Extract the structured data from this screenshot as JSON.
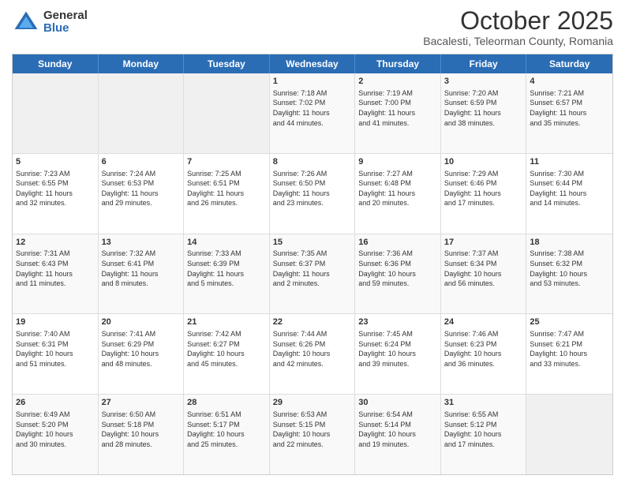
{
  "header": {
    "logo_general": "General",
    "logo_blue": "Blue",
    "title": "October 2025",
    "location": "Bacalesti, Teleorman County, Romania"
  },
  "weekdays": [
    "Sunday",
    "Monday",
    "Tuesday",
    "Wednesday",
    "Thursday",
    "Friday",
    "Saturday"
  ],
  "rows": [
    [
      {
        "day": "",
        "info": ""
      },
      {
        "day": "",
        "info": ""
      },
      {
        "day": "",
        "info": ""
      },
      {
        "day": "1",
        "info": "Sunrise: 7:18 AM\nSunset: 7:02 PM\nDaylight: 11 hours\nand 44 minutes."
      },
      {
        "day": "2",
        "info": "Sunrise: 7:19 AM\nSunset: 7:00 PM\nDaylight: 11 hours\nand 41 minutes."
      },
      {
        "day": "3",
        "info": "Sunrise: 7:20 AM\nSunset: 6:59 PM\nDaylight: 11 hours\nand 38 minutes."
      },
      {
        "day": "4",
        "info": "Sunrise: 7:21 AM\nSunset: 6:57 PM\nDaylight: 11 hours\nand 35 minutes."
      }
    ],
    [
      {
        "day": "5",
        "info": "Sunrise: 7:23 AM\nSunset: 6:55 PM\nDaylight: 11 hours\nand 32 minutes."
      },
      {
        "day": "6",
        "info": "Sunrise: 7:24 AM\nSunset: 6:53 PM\nDaylight: 11 hours\nand 29 minutes."
      },
      {
        "day": "7",
        "info": "Sunrise: 7:25 AM\nSunset: 6:51 PM\nDaylight: 11 hours\nand 26 minutes."
      },
      {
        "day": "8",
        "info": "Sunrise: 7:26 AM\nSunset: 6:50 PM\nDaylight: 11 hours\nand 23 minutes."
      },
      {
        "day": "9",
        "info": "Sunrise: 7:27 AM\nSunset: 6:48 PM\nDaylight: 11 hours\nand 20 minutes."
      },
      {
        "day": "10",
        "info": "Sunrise: 7:29 AM\nSunset: 6:46 PM\nDaylight: 11 hours\nand 17 minutes."
      },
      {
        "day": "11",
        "info": "Sunrise: 7:30 AM\nSunset: 6:44 PM\nDaylight: 11 hours\nand 14 minutes."
      }
    ],
    [
      {
        "day": "12",
        "info": "Sunrise: 7:31 AM\nSunset: 6:43 PM\nDaylight: 11 hours\nand 11 minutes."
      },
      {
        "day": "13",
        "info": "Sunrise: 7:32 AM\nSunset: 6:41 PM\nDaylight: 11 hours\nand 8 minutes."
      },
      {
        "day": "14",
        "info": "Sunrise: 7:33 AM\nSunset: 6:39 PM\nDaylight: 11 hours\nand 5 minutes."
      },
      {
        "day": "15",
        "info": "Sunrise: 7:35 AM\nSunset: 6:37 PM\nDaylight: 11 hours\nand 2 minutes."
      },
      {
        "day": "16",
        "info": "Sunrise: 7:36 AM\nSunset: 6:36 PM\nDaylight: 10 hours\nand 59 minutes."
      },
      {
        "day": "17",
        "info": "Sunrise: 7:37 AM\nSunset: 6:34 PM\nDaylight: 10 hours\nand 56 minutes."
      },
      {
        "day": "18",
        "info": "Sunrise: 7:38 AM\nSunset: 6:32 PM\nDaylight: 10 hours\nand 53 minutes."
      }
    ],
    [
      {
        "day": "19",
        "info": "Sunrise: 7:40 AM\nSunset: 6:31 PM\nDaylight: 10 hours\nand 51 minutes."
      },
      {
        "day": "20",
        "info": "Sunrise: 7:41 AM\nSunset: 6:29 PM\nDaylight: 10 hours\nand 48 minutes."
      },
      {
        "day": "21",
        "info": "Sunrise: 7:42 AM\nSunset: 6:27 PM\nDaylight: 10 hours\nand 45 minutes."
      },
      {
        "day": "22",
        "info": "Sunrise: 7:44 AM\nSunset: 6:26 PM\nDaylight: 10 hours\nand 42 minutes."
      },
      {
        "day": "23",
        "info": "Sunrise: 7:45 AM\nSunset: 6:24 PM\nDaylight: 10 hours\nand 39 minutes."
      },
      {
        "day": "24",
        "info": "Sunrise: 7:46 AM\nSunset: 6:23 PM\nDaylight: 10 hours\nand 36 minutes."
      },
      {
        "day": "25",
        "info": "Sunrise: 7:47 AM\nSunset: 6:21 PM\nDaylight: 10 hours\nand 33 minutes."
      }
    ],
    [
      {
        "day": "26",
        "info": "Sunrise: 6:49 AM\nSunset: 5:20 PM\nDaylight: 10 hours\nand 30 minutes."
      },
      {
        "day": "27",
        "info": "Sunrise: 6:50 AM\nSunset: 5:18 PM\nDaylight: 10 hours\nand 28 minutes."
      },
      {
        "day": "28",
        "info": "Sunrise: 6:51 AM\nSunset: 5:17 PM\nDaylight: 10 hours\nand 25 minutes."
      },
      {
        "day": "29",
        "info": "Sunrise: 6:53 AM\nSunset: 5:15 PM\nDaylight: 10 hours\nand 22 minutes."
      },
      {
        "day": "30",
        "info": "Sunrise: 6:54 AM\nSunset: 5:14 PM\nDaylight: 10 hours\nand 19 minutes."
      },
      {
        "day": "31",
        "info": "Sunrise: 6:55 AM\nSunset: 5:12 PM\nDaylight: 10 hours\nand 17 minutes."
      },
      {
        "day": "",
        "info": ""
      }
    ]
  ]
}
